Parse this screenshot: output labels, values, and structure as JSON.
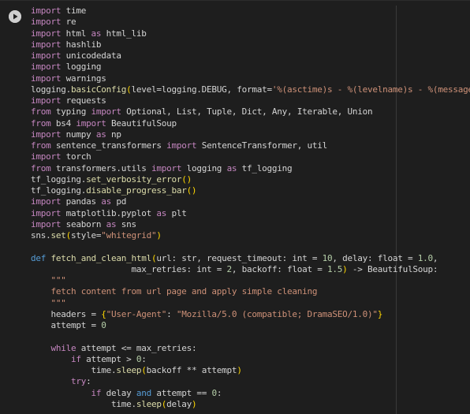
{
  "cell": {
    "run_button": "run-cell",
    "code_lines": [
      [
        {
          "c": "kw",
          "t": "import"
        },
        {
          "c": "",
          "t": " time"
        }
      ],
      [
        {
          "c": "kw",
          "t": "import"
        },
        {
          "c": "",
          "t": " re"
        }
      ],
      [
        {
          "c": "kw",
          "t": "import"
        },
        {
          "c": "",
          "t": " html "
        },
        {
          "c": "kw",
          "t": "as"
        },
        {
          "c": "",
          "t": " html_lib"
        }
      ],
      [
        {
          "c": "kw",
          "t": "import"
        },
        {
          "c": "",
          "t": " hashlib"
        }
      ],
      [
        {
          "c": "kw",
          "t": "import"
        },
        {
          "c": "",
          "t": " unicodedata"
        }
      ],
      [
        {
          "c": "kw",
          "t": "import"
        },
        {
          "c": "",
          "t": " logging"
        }
      ],
      [
        {
          "c": "kw",
          "t": "import"
        },
        {
          "c": "",
          "t": " warnings"
        }
      ],
      [
        {
          "c": "",
          "t": "logging."
        },
        {
          "c": "fn",
          "t": "basicConfig"
        },
        {
          "c": "pn",
          "t": "("
        },
        {
          "c": "",
          "t": "level=logging.DEBUG, format="
        },
        {
          "c": "st",
          "t": "'%(asctime)s - %(levelname)s - %(message)s'"
        },
        {
          "c": "pn",
          "t": ")"
        }
      ],
      [
        {
          "c": "kw",
          "t": "import"
        },
        {
          "c": "",
          "t": " requests"
        }
      ],
      [
        {
          "c": "kw",
          "t": "from"
        },
        {
          "c": "",
          "t": " typing "
        },
        {
          "c": "kw",
          "t": "import"
        },
        {
          "c": "",
          "t": " Optional, List, Tuple, Dict, Any, Iterable, Union"
        }
      ],
      [
        {
          "c": "kw",
          "t": "from"
        },
        {
          "c": "",
          "t": " bs4 "
        },
        {
          "c": "kw",
          "t": "import"
        },
        {
          "c": "",
          "t": " BeautifulSoup"
        }
      ],
      [
        {
          "c": "kw",
          "t": "import"
        },
        {
          "c": "",
          "t": " numpy "
        },
        {
          "c": "kw",
          "t": "as"
        },
        {
          "c": "",
          "t": " np"
        }
      ],
      [
        {
          "c": "kw",
          "t": "from"
        },
        {
          "c": "",
          "t": " sentence_transformers "
        },
        {
          "c": "kw",
          "t": "import"
        },
        {
          "c": "",
          "t": " SentenceTransformer, util"
        }
      ],
      [
        {
          "c": "kw",
          "t": "import"
        },
        {
          "c": "",
          "t": " torch"
        }
      ],
      [
        {
          "c": "kw",
          "t": "from"
        },
        {
          "c": "",
          "t": " transformers.utils "
        },
        {
          "c": "kw",
          "t": "import"
        },
        {
          "c": "",
          "t": " logging "
        },
        {
          "c": "kw",
          "t": "as"
        },
        {
          "c": "",
          "t": " tf_logging"
        }
      ],
      [
        {
          "c": "",
          "t": "tf_logging."
        },
        {
          "c": "fn",
          "t": "set_verbosity_error"
        },
        {
          "c": "pn",
          "t": "()"
        }
      ],
      [
        {
          "c": "",
          "t": "tf_logging."
        },
        {
          "c": "fn",
          "t": "disable_progress_bar"
        },
        {
          "c": "pn",
          "t": "()"
        }
      ],
      [
        {
          "c": "kw",
          "t": "import"
        },
        {
          "c": "",
          "t": " pandas "
        },
        {
          "c": "kw",
          "t": "as"
        },
        {
          "c": "",
          "t": " pd"
        }
      ],
      [
        {
          "c": "kw",
          "t": "import"
        },
        {
          "c": "",
          "t": " matplotlib.pyplot "
        },
        {
          "c": "kw",
          "t": "as"
        },
        {
          "c": "",
          "t": " plt"
        }
      ],
      [
        {
          "c": "kw",
          "t": "import"
        },
        {
          "c": "",
          "t": " seaborn "
        },
        {
          "c": "kw",
          "t": "as"
        },
        {
          "c": "",
          "t": " sns"
        }
      ],
      [
        {
          "c": "",
          "t": "sns."
        },
        {
          "c": "fn",
          "t": "set"
        },
        {
          "c": "pn",
          "t": "("
        },
        {
          "c": "",
          "t": "style="
        },
        {
          "c": "st",
          "t": "\"whitegrid\""
        },
        {
          "c": "pn",
          "t": ")"
        }
      ],
      [
        {
          "c": "",
          "t": ""
        }
      ],
      [
        {
          "c": "def",
          "t": "def"
        },
        {
          "c": "",
          "t": " "
        },
        {
          "c": "fn",
          "t": "fetch_and_clean_html"
        },
        {
          "c": "pn",
          "t": "("
        },
        {
          "c": "",
          "t": "url: str, request_timeout: int = "
        },
        {
          "c": "nm",
          "t": "10"
        },
        {
          "c": "",
          "t": ", delay: float = "
        },
        {
          "c": "nm",
          "t": "1.0"
        },
        {
          "c": "",
          "t": ","
        }
      ],
      [
        {
          "c": "",
          "t": "                    max_retries: int = "
        },
        {
          "c": "nm",
          "t": "2"
        },
        {
          "c": "",
          "t": ", backoff: float = "
        },
        {
          "c": "nm",
          "t": "1.5"
        },
        {
          "c": "pn",
          "t": ")"
        },
        {
          "c": "",
          "t": " -> BeautifulSoup:"
        }
      ],
      [
        {
          "c": "st",
          "t": "    \"\"\""
        }
      ],
      [
        {
          "c": "st",
          "t": "    fetch content from url page and apply simple cleaning"
        }
      ],
      [
        {
          "c": "st",
          "t": "    \"\"\""
        }
      ],
      [
        {
          "c": "",
          "t": "    headers = "
        },
        {
          "c": "pn",
          "t": "{"
        },
        {
          "c": "st",
          "t": "\"User-Agent\""
        },
        {
          "c": "",
          "t": ": "
        },
        {
          "c": "st",
          "t": "\"Mozilla/5.0 (compatible; DramaSEO/1.0)\""
        },
        {
          "c": "pn",
          "t": "}"
        }
      ],
      [
        {
          "c": "",
          "t": "    attempt = "
        },
        {
          "c": "nm",
          "t": "0"
        }
      ],
      [
        {
          "c": "",
          "t": ""
        }
      ],
      [
        {
          "c": "",
          "t": "    "
        },
        {
          "c": "kw",
          "t": "while"
        },
        {
          "c": "",
          "t": " attempt <= max_retries:"
        }
      ],
      [
        {
          "c": "",
          "t": "        "
        },
        {
          "c": "kw",
          "t": "if"
        },
        {
          "c": "",
          "t": " attempt > "
        },
        {
          "c": "nm",
          "t": "0"
        },
        {
          "c": "",
          "t": ":"
        }
      ],
      [
        {
          "c": "",
          "t": "            time."
        },
        {
          "c": "fn",
          "t": "sleep"
        },
        {
          "c": "pn",
          "t": "("
        },
        {
          "c": "",
          "t": "backoff ** attempt"
        },
        {
          "c": "pn",
          "t": ")"
        }
      ],
      [
        {
          "c": "",
          "t": "        "
        },
        {
          "c": "kw",
          "t": "try"
        },
        {
          "c": "",
          "t": ":"
        }
      ],
      [
        {
          "c": "",
          "t": "            "
        },
        {
          "c": "kw",
          "t": "if"
        },
        {
          "c": "",
          "t": " delay "
        },
        {
          "c": "def",
          "t": "and"
        },
        {
          "c": "",
          "t": " attempt == "
        },
        {
          "c": "nm",
          "t": "0"
        },
        {
          "c": "",
          "t": ":"
        }
      ],
      [
        {
          "c": "",
          "t": "                time."
        },
        {
          "c": "fn",
          "t": "sleep"
        },
        {
          "c": "pn",
          "t": "("
        },
        {
          "c": "",
          "t": "delay"
        },
        {
          "c": "pn",
          "t": ")"
        }
      ]
    ]
  }
}
